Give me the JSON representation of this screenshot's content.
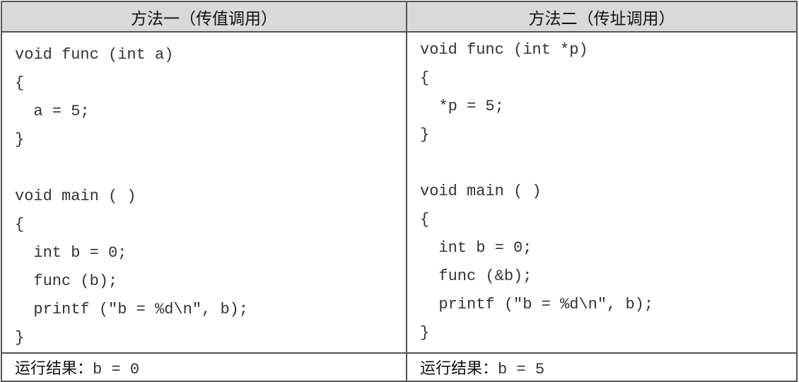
{
  "columns": [
    {
      "header": "方法一（传值调用）",
      "code": [
        "void func (int a)",
        "{",
        "  a = 5;",
        "}",
        "",
        "void main ( )",
        "{",
        "  int b = 0;",
        "  func (b);",
        "  printf (\"b = %d\\n\", b);",
        "}"
      ],
      "result_label": "运行结果：",
      "result_value": "b = 0"
    },
    {
      "header": "方法二（传址调用）",
      "code": [
        "void func (int *p)",
        "{",
        "  *p = 5;",
        "}",
        "",
        "void main ( )",
        "{",
        "  int b = 0;",
        "  func (&b);",
        "  printf (\"b = %d\\n\", b);",
        "}"
      ],
      "result_label": "运行结果：",
      "result_value": "b = 5"
    }
  ]
}
